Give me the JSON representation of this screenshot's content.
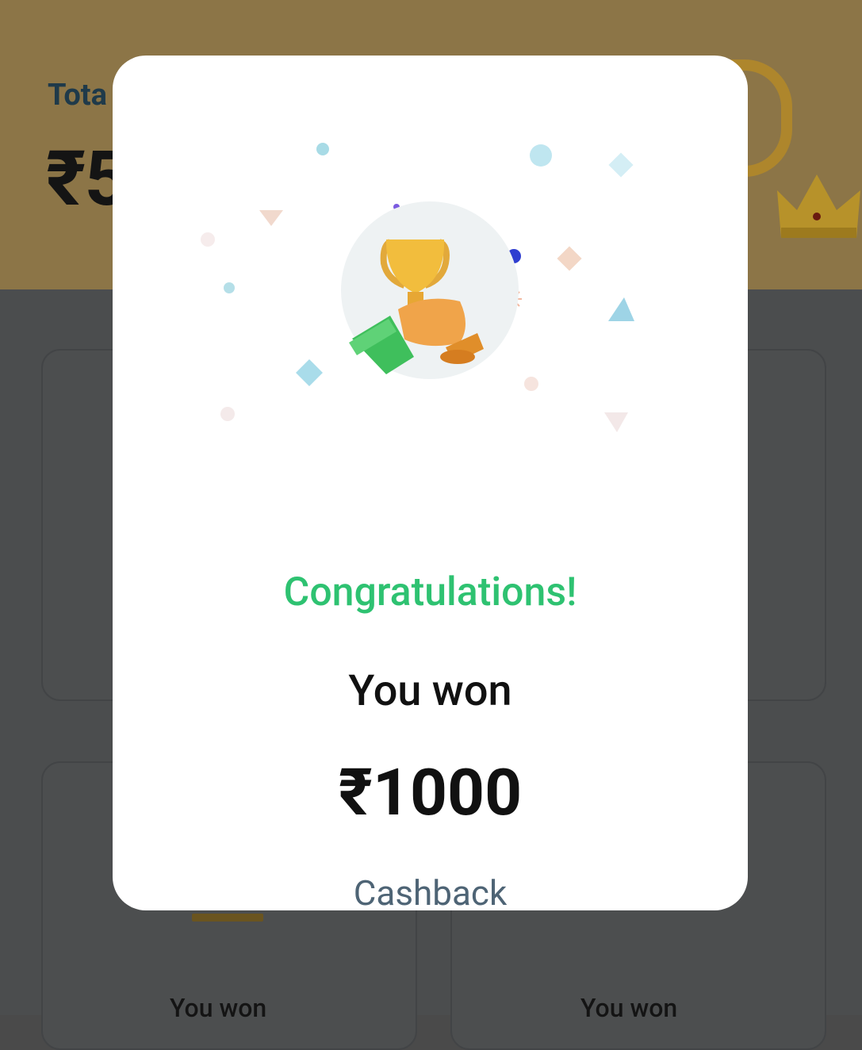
{
  "background": {
    "total_label": "Tota",
    "total_amount": "₹5",
    "cards": [
      {
        "label": "You won"
      },
      {
        "label": "You won"
      }
    ]
  },
  "modal": {
    "title": "Congratulations!",
    "subtitle": "You won",
    "amount": "₹1000",
    "reward_type": "Cashback",
    "illustration_icon": "trophy-icon"
  },
  "colors": {
    "accent_green": "#2ec271",
    "overlay": "#4a4a4a",
    "header_gold": "#8c7547"
  }
}
